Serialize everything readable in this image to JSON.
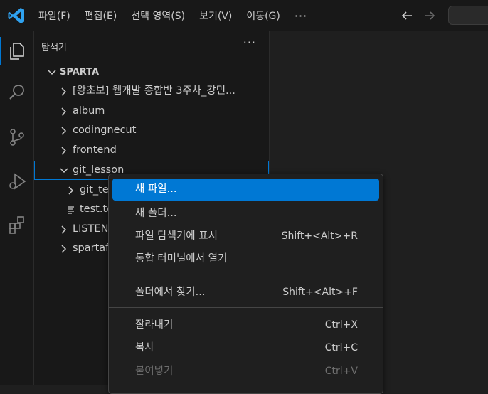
{
  "menubar": {
    "items": [
      "파일(F)",
      "편집(E)",
      "선택 영역(S)",
      "보기(V)",
      "이동(G)"
    ],
    "more": "···"
  },
  "sidebar": {
    "title": "탐색기",
    "more": "···",
    "section": "SPARTA",
    "tree": [
      {
        "label": "[왕초보] 웹개발 종합반 3주차_강민..."
      },
      {
        "label": "album"
      },
      {
        "label": "codingnecut"
      },
      {
        "label": "frontend"
      },
      {
        "label": "git_lesson"
      },
      {
        "label": "git_te"
      },
      {
        "label": "test.te"
      },
      {
        "label": "LISTEN"
      },
      {
        "label": "spartaf"
      }
    ]
  },
  "context_menu": {
    "items": [
      {
        "label": "새 파일...",
        "shortcut": ""
      },
      {
        "label": "새 폴더...",
        "shortcut": ""
      },
      {
        "label": "파일 탐색기에 표시",
        "shortcut": "Shift+<Alt>+R"
      },
      {
        "label": "통합 터미널에서 열기",
        "shortcut": ""
      },
      {
        "label": "폴더에서 찾기...",
        "shortcut": "Shift+<Alt>+F"
      },
      {
        "label": "잘라내기",
        "shortcut": "Ctrl+X"
      },
      {
        "label": "복사",
        "shortcut": "Ctrl+C"
      },
      {
        "label": "붙여넣기",
        "shortcut": "Ctrl+V"
      }
    ]
  },
  "colors": {
    "accent": "#0078d4",
    "background": "#1f1f1f",
    "panel": "#181818"
  }
}
